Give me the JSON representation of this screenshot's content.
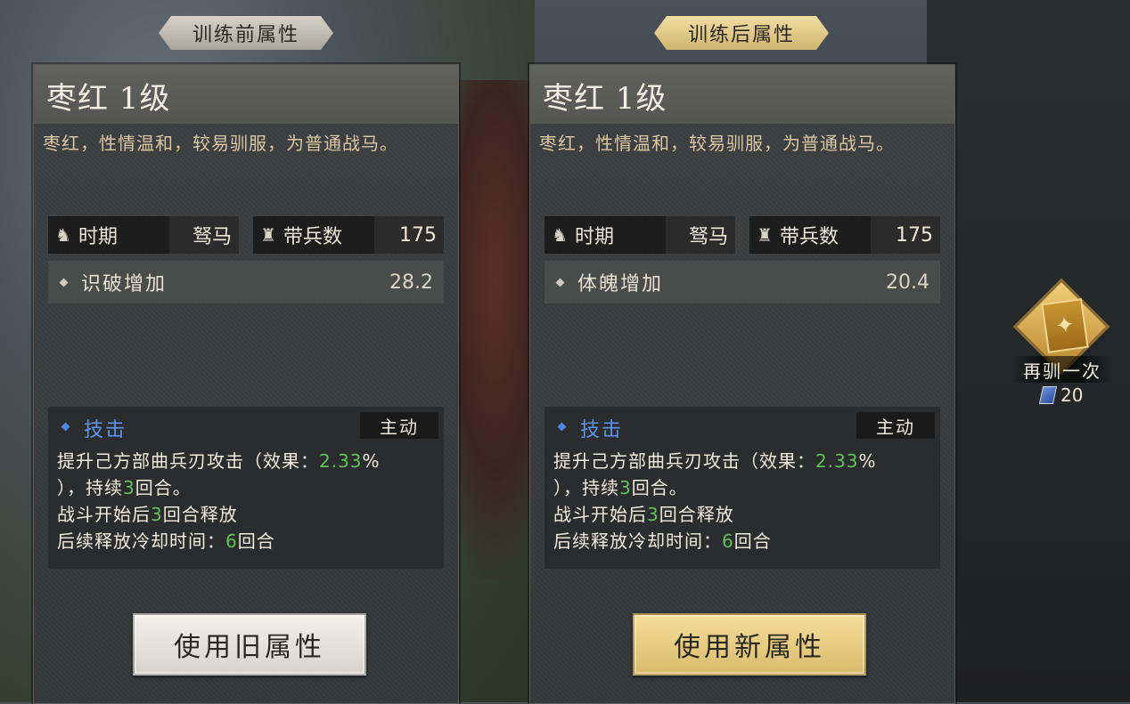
{
  "left": {
    "tab_label": "训练前属性",
    "horse_name": "枣红 1级",
    "description": "枣红，性情温和，较易驯服，为普通战马。",
    "period_label": "时期",
    "period_value": "驽马",
    "troops_label": "带兵数",
    "troops_value": "175",
    "attr_name": "识破增加",
    "attr_value": "28.2",
    "skill_name": "技击",
    "skill_type": "主动",
    "skill_line1_a": "提升己方部曲兵刃攻击（效果：",
    "skill_line1_b": "2.33",
    "skill_line1_c": "%",
    "skill_line2_a": "），持续",
    "skill_line2_b": "3",
    "skill_line2_c": "回合。",
    "skill_line3_a": "战斗开始后",
    "skill_line3_b": "3",
    "skill_line3_c": "回合释放",
    "skill_line4_a": "后续释放冷却时间：",
    "skill_line4_b": "6",
    "skill_line4_c": "回合",
    "button": "使用旧属性"
  },
  "right": {
    "tab_label": "训练后属性",
    "horse_name": "枣红 1级",
    "description": "枣红，性情温和，较易驯服，为普通战马。",
    "period_label": "时期",
    "period_value": "驽马",
    "troops_label": "带兵数",
    "troops_value": "175",
    "attr_name": "体魄增加",
    "attr_value": "20.4",
    "skill_name": "技击",
    "skill_type": "主动",
    "skill_line1_a": "提升己方部曲兵刃攻击（效果：",
    "skill_line1_b": "2.33",
    "skill_line1_c": "%",
    "skill_line2_a": "），持续",
    "skill_line2_b": "3",
    "skill_line2_c": "回合。",
    "skill_line3_a": "战斗开始后",
    "skill_line3_b": "3",
    "skill_line3_c": "回合释放",
    "skill_line4_a": "后续释放冷却时间：",
    "skill_line4_b": "6",
    "skill_line4_c": "回合",
    "button": "使用新属性"
  },
  "retame": {
    "label": "再驯一次",
    "cost": "20",
    "cost_icon": "book-icon"
  },
  "icons": {
    "horse_icon": "♞",
    "troops_icon": "♜",
    "dragon_icon": "✦"
  },
  "colors": {
    "highlight_green": "#5fc25a",
    "skill_blue": "#5d95ef",
    "new_button_gold": "#e8cc82"
  }
}
